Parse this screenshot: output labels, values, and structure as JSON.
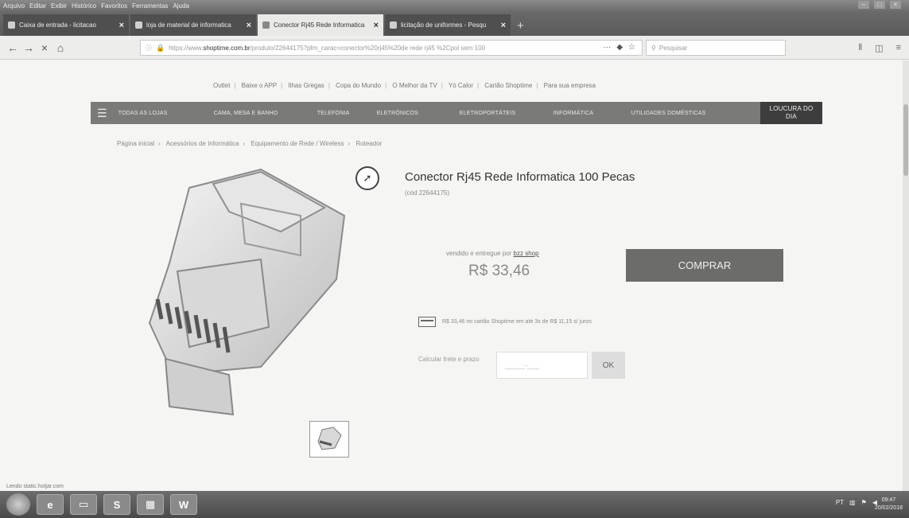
{
  "browser": {
    "menu": [
      "Arquivo",
      "Editar",
      "Exibir",
      "Histórico",
      "Favoritos",
      "Ferramentas",
      "Ajuda"
    ],
    "tabs": [
      {
        "title": "Caixa de entrada - licitacao",
        "active": false
      },
      {
        "title": "loja de material de informatica",
        "active": false
      },
      {
        "title": "Conector Rj45 Rede Informatica",
        "active": true
      },
      {
        "title": "licitação de uniformes - Pesqu",
        "active": false
      }
    ],
    "url_prefix": "https://www.",
    "url_domain": "shoptime.com.br",
    "url_rest": "/produto/22644175?pfm_carac=conector%20rj45%20de rede rj45 %2Cpol sem 100",
    "search_placeholder": "Pesquisar"
  },
  "site": {
    "top_links": [
      "Outlet",
      "Baixe o APP",
      "Ilhas Gregas",
      "Copa do Mundo",
      "O Melhor da TV",
      "Yó Calor",
      "Cartão Shoptime",
      "Para sua empresa"
    ],
    "categories": [
      "TODAS AS LOJAS",
      "CAMA, MESA E BANHO",
      "TELEFONIA",
      "ELETRÔNICOS",
      "ELETROPORTÁTEIS",
      "INFORMÁTICA",
      "UTILIDADES DOMÉSTICAS"
    ],
    "promo_line1": "LOUCURA DO",
    "promo_line2": "DIA"
  },
  "breadcrumb": [
    "Página inicial",
    "Acessórios de Informática",
    "Equipamento de Rede / Wireless",
    "Roteador"
  ],
  "product": {
    "title": "Conector Rj45 Rede Informatica 100 Pecas",
    "code": "(cód 22644175)",
    "seller_prefix": "vendido e entregue por",
    "seller": "bzz shop",
    "price": "R$ 33,46",
    "buy_label": "COMPRAR",
    "installment": "R$ 33,46 no cartão Shoptime em até 3x de R$ 11,15 s/ juros",
    "shipping_label": "Calcular frete e prazo",
    "cep_placeholder": "_____-___",
    "ok_label": "OK"
  },
  "status_text": "Lendo static.hotjar.com",
  "taskbar": {
    "apps": [
      "",
      "",
      "",
      "S",
      "",
      "W"
    ],
    "tray": "PT",
    "time": "09:47",
    "date": "20/02/2018"
  },
  "colors": {
    "nav_bar": "#7a7a78",
    "promo": "#3d3d3d",
    "buy_button": "#6c6c6a"
  }
}
